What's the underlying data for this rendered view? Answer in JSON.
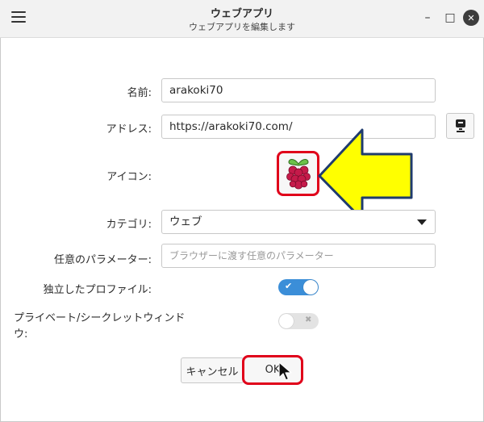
{
  "window": {
    "title": "ウェブアプリ",
    "subtitle": "ウェブアプリを編集します",
    "minimize": "–",
    "maximize": "□",
    "close": "✕"
  },
  "form": {
    "name_label": "名前:",
    "name_value": "arakoki70",
    "address_label": "アドレス:",
    "address_value": "https://arakoki70.com/",
    "icon_label": "アイコン:",
    "category_label": "カテゴリ:",
    "category_value": "ウェブ",
    "params_label": "任意のパラメーター:",
    "params_placeholder": "ブラウザーに渡す任意のパラメーター",
    "profile_label": "独立したプロファイル:",
    "profile_enabled": true,
    "private_label_line1": "プライベート/シークレットウィンド",
    "private_label_line2": "ウ:",
    "private_enabled": false
  },
  "buttons": {
    "cancel": "キャンセル",
    "ok": "OK"
  },
  "colors": {
    "accent": "#3b8ed8",
    "highlight_border": "#e0001a",
    "arrow_fill": "#ffff00",
    "arrow_stroke": "#1f3b6e"
  },
  "icons": {
    "menu": "hamburger-menu-icon",
    "favicon_fetch": "download-favicon-icon",
    "app_icon": "raspberry-icon",
    "annotation": "yellow-arrow-pointer",
    "cursor": "mouse-cursor"
  }
}
